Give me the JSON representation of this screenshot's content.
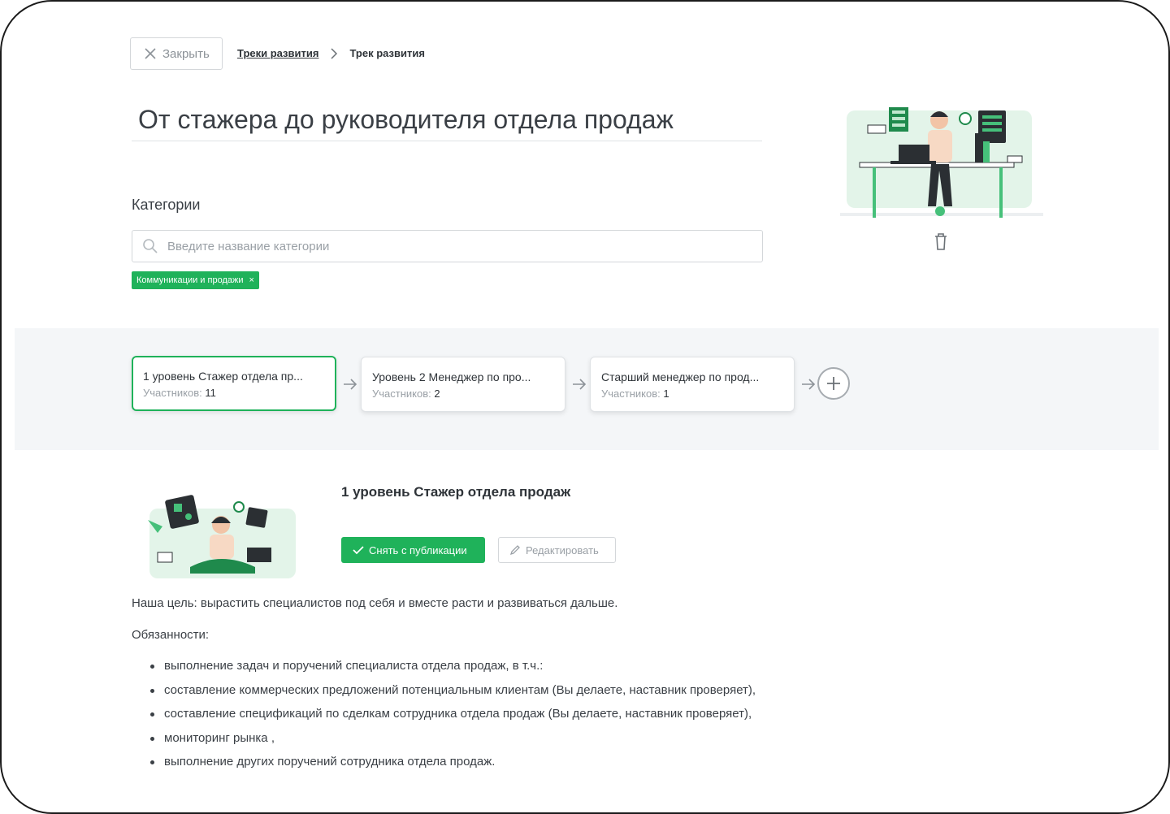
{
  "header": {
    "close_label": "Закрыть",
    "breadcrumb_link": "Треки развития",
    "breadcrumb_current": "Трек развития"
  },
  "track": {
    "title": "От стажера до руководителя отдела продаж"
  },
  "categories": {
    "label": "Категории",
    "search_placeholder": "Введите название категории",
    "selected_tag": "Коммуникации и продажи",
    "tag_remove": "×"
  },
  "levels": {
    "items": [
      {
        "name": "1 уровень Стажер отдела пр...",
        "count_label": "Участников:",
        "count": "11",
        "active": true
      },
      {
        "name": "Уровень 2 Менеджер по про...",
        "count_label": "Участников:",
        "count": "2",
        "active": false
      },
      {
        "name": "Старший менеджер по прод...",
        "count_label": "Участников:",
        "count": "1",
        "active": false
      }
    ]
  },
  "level_detail": {
    "title": "1 уровень Стажер отдела продаж",
    "unpublish_label": "Снять с публикации",
    "edit_label": "Редактировать",
    "goal": "Наша цель: вырастить специалистов под себя и вместе расти и развиваться дальше.",
    "duties_label": "Обязанности:",
    "duties": [
      "выполнение задач и поручений специалиста отдела продаж, в т.ч.:",
      "составление коммерческих предложений потенциальным клиентам (Вы делаете, наставник проверяет),",
      "составление спецификаций по сделкам сотрудника отдела продаж (Вы делаете, наставник проверяет),",
      "мониторинг рынка  ,",
      "выполнение других поручений сотрудника отдела продаж."
    ]
  },
  "colors": {
    "accent": "#1fb25a",
    "band": "#f4f6f8",
    "text": "#3a3f45",
    "muted": "#9aa0a6"
  },
  "icons": {
    "close": "close-icon",
    "chevron": "chevron-right-icon",
    "search": "search-icon",
    "trash": "trash-icon",
    "arrow": "arrow-right-icon",
    "add": "plus-icon",
    "check": "check-icon",
    "pencil": "pencil-icon"
  }
}
